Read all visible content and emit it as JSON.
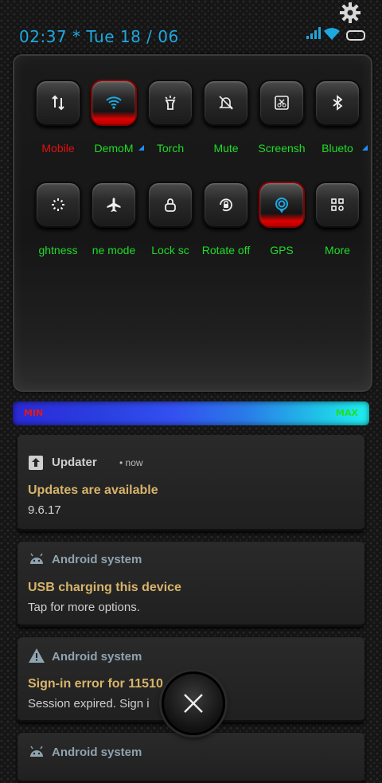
{
  "status_bar": {
    "time_date": "02:37 * Tue 18 / 06",
    "icons": [
      "settings-gear-icon",
      "signal-icon",
      "wifi-icon",
      "battery-icon"
    ]
  },
  "quick_settings": {
    "row1": [
      {
        "label": "Mobile",
        "icon": "mobile-data-icon",
        "active": false,
        "label_color": "#e01010"
      },
      {
        "label": "DemoM",
        "icon": "wifi-icon",
        "active": true,
        "label_color": "#1fdc2a"
      },
      {
        "label": "Torch",
        "icon": "torch-icon",
        "active": false,
        "label_color": "#1fdc2a"
      },
      {
        "label": "Mute",
        "icon": "mute-icon",
        "active": false,
        "label_color": "#1fdc2a"
      },
      {
        "label": "Screensh",
        "icon": "screenshot-icon",
        "active": false,
        "label_color": "#1fdc2a"
      },
      {
        "label": "Blueto",
        "icon": "bluetooth-icon",
        "active": false,
        "label_color": "#1fdc2a"
      }
    ],
    "row2": [
      {
        "label": "ghtness",
        "icon": "brightness-icon",
        "active": false
      },
      {
        "label": "ne mode",
        "icon": "airplane-icon",
        "active": false
      },
      {
        "label": "Lock sc",
        "icon": "lock-icon",
        "active": false
      },
      {
        "label": "Rotate off",
        "icon": "rotate-lock-icon",
        "active": false
      },
      {
        "label": "GPS",
        "icon": "gps-icon",
        "active": true
      },
      {
        "label": "More",
        "icon": "more-icon",
        "active": false
      }
    ]
  },
  "brightness": {
    "min_label": "MIN",
    "max_label": "MAX"
  },
  "notifications": [
    {
      "app": "Updater",
      "time": "now",
      "title": "Updates are available",
      "text": "9.6.17",
      "icon": "update-icon"
    },
    {
      "app": "Android system",
      "title": "USB charging this device",
      "text": "Tap for more options.",
      "icon": "android-icon"
    },
    {
      "app": "Android system",
      "title": "Sign-in error for 11510",
      "text": "Session expired. Sign i",
      "icon": "warning-icon"
    },
    {
      "app": "Android system",
      "icon": "android-icon"
    }
  ],
  "colors": {
    "accent_blue": "#1ea8e0",
    "label_green": "#1fdc2a",
    "label_red": "#e01010",
    "notif_title": "#d8b46a",
    "notif_app": "#8fa3b0"
  }
}
